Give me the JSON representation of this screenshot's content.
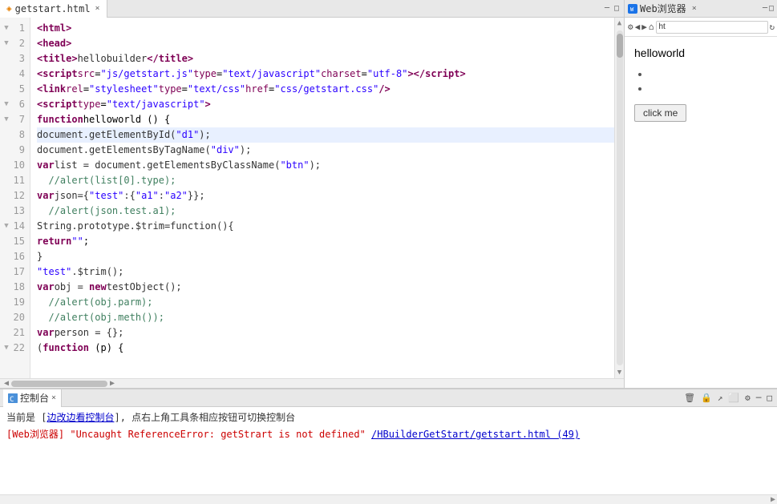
{
  "editor": {
    "tab_label": "getstart.html",
    "tab_close": "×",
    "url": "ht",
    "lines": [
      {
        "num": "1",
        "fold": "▼",
        "code_html": "<span class='tag'>&lt;html&gt;</span>"
      },
      {
        "num": "2",
        "fold": "▼",
        "code_html": "    <span class='tag'>&lt;head&gt;</span>"
      },
      {
        "num": "3",
        "fold": "",
        "code_html": "        <span class='tag'>&lt;title&gt;</span><span class='normal'>hellobuilder</span><span class='tag'>&lt;/title&gt;</span>"
      },
      {
        "num": "4",
        "fold": "",
        "code_html": "        <span class='tag'>&lt;script</span> <span class='attr'>src</span>=<span class='str'>\"js/getstart.js\"</span> <span class='attr'>type</span>=<span class='str'>\"text/javascript\"</span> <span class='attr'>charset</span>=<span class='str'>\"utf-8\"</span><span class='tag'>&gt;&lt;/script&gt;</span>"
      },
      {
        "num": "5",
        "fold": "",
        "code_html": "        <span class='tag'>&lt;link</span> <span class='attr'>rel</span>=<span class='str'>\"stylesheet\"</span> <span class='attr'>type</span>=<span class='str'>\"text/css\"</span> <span class='attr'>href</span>=<span class='str'>\"css/getstart.css\"</span><span class='tag'>/&gt;</span>"
      },
      {
        "num": "6",
        "fold": "▼",
        "code_html": "        <span class='tag'>&lt;script</span> <span class='attr'>type</span>=<span class='str'>\"text/javascript\"</span><span class='tag'>&gt;</span>"
      },
      {
        "num": "7",
        "fold": "▼",
        "code_html": "            <span class='kw'>function</span> <span class='fn-name'>helloworld</span> () {"
      },
      {
        "num": "8",
        "fold": "",
        "code_html": "                <span class='normal'>document.getElementById(<span class='str'>\"d1\"</span>);</span>"
      },
      {
        "num": "9",
        "fold": "",
        "code_html": "                <span class='normal'>document.getElementsByTagName(<span class='str'>\"div\"</span>);</span>"
      },
      {
        "num": "10",
        "fold": "",
        "code_html": "                <span class='kw'>var</span> <span class='normal'>list = document.getElementsByClassName(<span class='str'>\"btn\"</span>);</span>"
      },
      {
        "num": "11",
        "fold": "",
        "code_html": "<span class='comment'>  //</span>        <span class='comment'>alert(list[0].type);</span>"
      },
      {
        "num": "12",
        "fold": "",
        "code_html": "                <span class='kw'>var</span> <span class='normal'>json={<span class='str'>\"test\"</span>:{<span class='str'>\"a1\"</span>:<span class='str'>\"a2\"</span>}};</span>"
      },
      {
        "num": "13",
        "fold": "",
        "code_html": "<span class='comment'>  //</span>        <span class='comment'>alert(json.test.a1);</span>"
      },
      {
        "num": "14",
        "fold": "▼",
        "code_html": "                <span class='normal'>String.prototype.$trim=function(){</span>"
      },
      {
        "num": "15",
        "fold": "",
        "code_html": "                    <span class='kw'>return</span> <span class='str'>\"\"</span>;"
      },
      {
        "num": "16",
        "fold": "",
        "code_html": "                <span class='normal'>}</span>"
      },
      {
        "num": "17",
        "fold": "",
        "code_html": "                <span class='str'>\"test\"</span><span class='normal'>.$trim();</span>"
      },
      {
        "num": "18",
        "fold": "",
        "code_html": "                <span class='kw'>var</span> <span class='normal'>obj = </span><span class='kw'>new</span> <span class='normal'>testObject();</span>"
      },
      {
        "num": "19",
        "fold": "",
        "code_html": "<span class='comment'>  //</span>        <span class='comment'>alert(obj.parm);</span>"
      },
      {
        "num": "20",
        "fold": "",
        "code_html": "<span class='comment'>  //</span>        <span class='comment'>alert(obj.meth());</span>"
      },
      {
        "num": "21",
        "fold": "",
        "code_html": "                <span class='kw'>var</span> <span class='normal'>person = {};</span>"
      },
      {
        "num": "22",
        "fold": "▼",
        "code_html": "                <span class='normal'>(</span><span class='kw'>function</span> (p) {"
      }
    ]
  },
  "browser": {
    "tab_label": "Web浏览器",
    "tab_close": "×",
    "url_text": "ht",
    "content": {
      "heading": "helloworld",
      "bullet1": "",
      "bullet2": "",
      "button_label": "click me"
    },
    "toolbar_buttons": [
      "⚙",
      "◀",
      "▶",
      "↻",
      "⌂"
    ]
  },
  "console": {
    "tab_label": "控制台",
    "tab_close": "×",
    "hint_text": "当前是 [边改边看控制台], 点右上角工具条相应按钮可切换控制台",
    "hint_link": "边改边看控制台",
    "error_line": "[Web浏览器]  \"Uncaught ReferenceError: getStrart is not defined\"  /HBuilderGetStart/getstart.html (49)"
  },
  "icons": {
    "minimize": "─",
    "maximize": "□",
    "close": "×",
    "fold_open": "▼",
    "fold_closed": "▶",
    "scroll_up": "▲",
    "scroll_down": "▼",
    "scroll_left": "◀",
    "scroll_right": "▶"
  }
}
